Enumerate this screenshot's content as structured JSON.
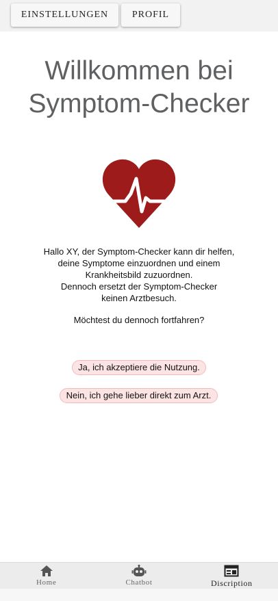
{
  "header": {
    "settings_label": "EINSTELLUNGEN",
    "profile_label": "PROFIL"
  },
  "main": {
    "title_line1": "Willkommen bei",
    "title_line2": "Symptom-Checker",
    "intro_lines": [
      "Hallo XY, der Symptom-Checker kann dir helfen,",
      "deine Symptome einzuordnen und einem",
      "Krankheitsbild zuzuordnen.",
      "Dennoch ersetzt der Symptom-Checker",
      "keinen Arztbesuch."
    ],
    "question": "Möchtest du dennoch fortfahren?",
    "accept_label": "Ja, ich akzeptiere die Nutzung.",
    "decline_label": "Nein, ich gehe lieber direkt zum Arzt.",
    "heart_color": "#9e1b1b"
  },
  "bottom_nav": {
    "items": [
      {
        "label": "Home",
        "icon": "home-icon"
      },
      {
        "label": "Chatbot",
        "icon": "robot-icon"
      },
      {
        "label": "Discription",
        "icon": "description-icon"
      }
    ],
    "active_index": 2
  }
}
